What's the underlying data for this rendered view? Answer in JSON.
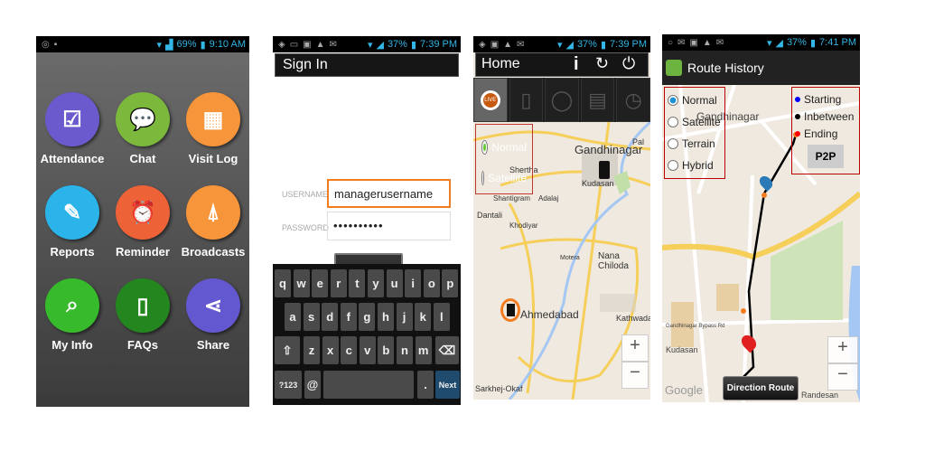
{
  "panel_home_grid": {
    "status": {
      "battery": "69%",
      "time": "9:10 AM"
    },
    "tiles": [
      {
        "label": "Attendance",
        "icon": "user-check-icon",
        "color": "#6a5acd"
      },
      {
        "label": "Chat",
        "icon": "chat-bubbles-icon",
        "color": "#7cb83b"
      },
      {
        "label": "Visit Log",
        "icon": "calendar-clock-icon",
        "color": "#f7953a"
      },
      {
        "label": "Reports",
        "icon": "report-edit-icon",
        "color": "#2ab4ea"
      },
      {
        "label": "Reminder",
        "icon": "calendar-alarm-icon",
        "color": "#ee6238"
      },
      {
        "label": "Broadcasts",
        "icon": "antenna-tower-icon",
        "color": "#f7953a"
      },
      {
        "label": "My Info",
        "icon": "phone-search-icon",
        "color": "#37bb2d"
      },
      {
        "label": "FAQs",
        "icon": "faq-book-icon",
        "color": "#23861f"
      },
      {
        "label": "Share",
        "icon": "share-icon",
        "color": "#6458d0"
      }
    ]
  },
  "panel_sign_in": {
    "status": {
      "battery": "37%",
      "time": "7:39 PM"
    },
    "title": "Sign In",
    "username_label": "USERNAME",
    "username_value": "managerusername",
    "password_label": "PASSWORD",
    "password_value": "••••••••••",
    "keyboard": {
      "row1": [
        "q",
        "w",
        "e",
        "r",
        "t",
        "y",
        "u",
        "i",
        "o",
        "p"
      ],
      "row2": [
        "a",
        "s",
        "d",
        "f",
        "g",
        "h",
        "j",
        "k",
        "l"
      ],
      "row3": [
        "z",
        "x",
        "c",
        "v",
        "b",
        "n",
        "m"
      ],
      "sym": "?123",
      "at": "@",
      "dot": ".",
      "next": "Next"
    },
    "accent": "#f47c20"
  },
  "panel_home_map": {
    "status": {
      "battery": "37%",
      "time": "7:39 PM"
    },
    "title": "Home",
    "map_types": [
      "Normal",
      "Satellite"
    ],
    "places": [
      "Gandhinagar",
      "Shertha",
      "Kudasan",
      "Adalaj",
      "Shantigram",
      "Dantali",
      "Khodiyar",
      "Nana Chiloda",
      "Motera",
      "Ahmedabad",
      "Kathwada",
      "Sarkhej-Okaf",
      "Pal"
    ],
    "zoom_in": "+",
    "zoom_out": "−"
  },
  "panel_route_history": {
    "status": {
      "battery": "37%",
      "time": "7:41 PM"
    },
    "title": "Route History",
    "map_types": [
      "Normal",
      "Satellite",
      "Terrain",
      "Hybrid"
    ],
    "selected_map_type": "Normal",
    "legend": [
      {
        "label": "Starting",
        "color": "#0000ff"
      },
      {
        "label": "Inbetween",
        "color": "#000000"
      },
      {
        "label": "Ending",
        "color": "#ff0000"
      }
    ],
    "p2p_label": "P2P",
    "direction_route_label": "Direction Route",
    "places": [
      "Gandhinagar",
      "Kudasan",
      "Randesan",
      "Gandhinagar Bypass Rd"
    ],
    "google": "Google",
    "zoom_in": "+",
    "zoom_out": "−"
  }
}
